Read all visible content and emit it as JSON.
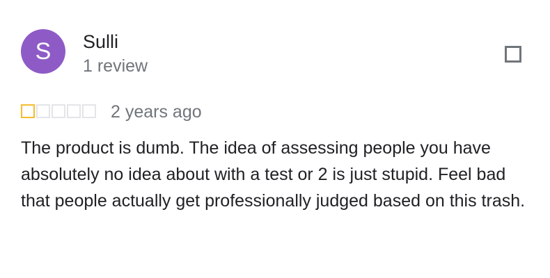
{
  "reviewer": {
    "initial": "S",
    "name": "Sulli",
    "review_count": "1 review",
    "avatar_color": "#8e5bc6"
  },
  "review": {
    "rating": 1,
    "max_rating": 5,
    "date": "2 years ago",
    "text": "The product is dumb. The idea of assessing people you have absolutely no idea about with a test or 2 is just stupid. Feel bad that people actually get professionally judged based on this trash."
  },
  "icons": {
    "menu": "checkbox-icon"
  },
  "colors": {
    "star_filled": "#f5bc2c",
    "star_empty": "#e3e5e8"
  }
}
